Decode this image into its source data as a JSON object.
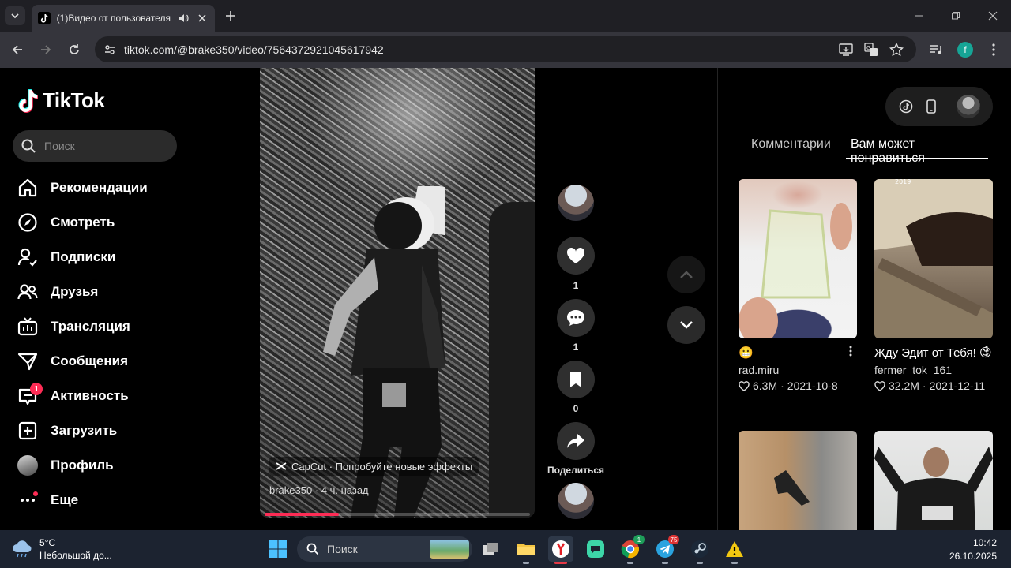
{
  "browser": {
    "tab_title": "(1)Видео от пользователя",
    "url": "tiktok.com/@brake350/video/7564372921045617942",
    "profile_initial": "f"
  },
  "sidebar": {
    "logo_text": "TikTok",
    "search_placeholder": "Поиск",
    "items": [
      {
        "label": "Рекомендации",
        "icon": "home-icon"
      },
      {
        "label": "Смотреть",
        "icon": "compass-icon"
      },
      {
        "label": "Подписки",
        "icon": "following-icon"
      },
      {
        "label": "Друзья",
        "icon": "friends-icon"
      },
      {
        "label": "Трансляция",
        "icon": "live-icon"
      },
      {
        "label": "Сообщения",
        "icon": "messages-icon"
      },
      {
        "label": "Активность",
        "icon": "activity-icon",
        "badge": "1"
      },
      {
        "label": "Загрузить",
        "icon": "upload-icon"
      },
      {
        "label": "Профиль",
        "icon": "avatar"
      },
      {
        "label": "Еще",
        "icon": "more-icon"
      }
    ]
  },
  "video": {
    "capcut_text": "CapCut · Попробуйте новые эффекты",
    "author_time": "brake350 · 4 ч. назад",
    "progress": 0.28
  },
  "actions": {
    "likes": "1",
    "comments": "1",
    "saves": "0",
    "share_label": "Поделиться"
  },
  "right_panel": {
    "tab_comments": "Комментарии",
    "tab_recommended": "Вам может понравиться",
    "cards": [
      {
        "caption": "😬",
        "author": "rad.miru",
        "likes": "6.3M",
        "date": "2021-10-8"
      },
      {
        "caption": "Жду Эдит от Тебя! 😊",
        "author": "fermer_tok_161",
        "likes": "32.2M",
        "date": "2021-12-11",
        "thumb_overlay": "2019"
      }
    ]
  },
  "taskbar": {
    "temperature": "5°C",
    "weather": "Небольшой до...",
    "search_placeholder": "Поиск",
    "time": "10:42",
    "date": "26.10.2025",
    "badges": {
      "chrome": "1",
      "telegram": "75"
    }
  },
  "colors": {
    "accent": "#fe2c55",
    "bg": "#000000"
  }
}
